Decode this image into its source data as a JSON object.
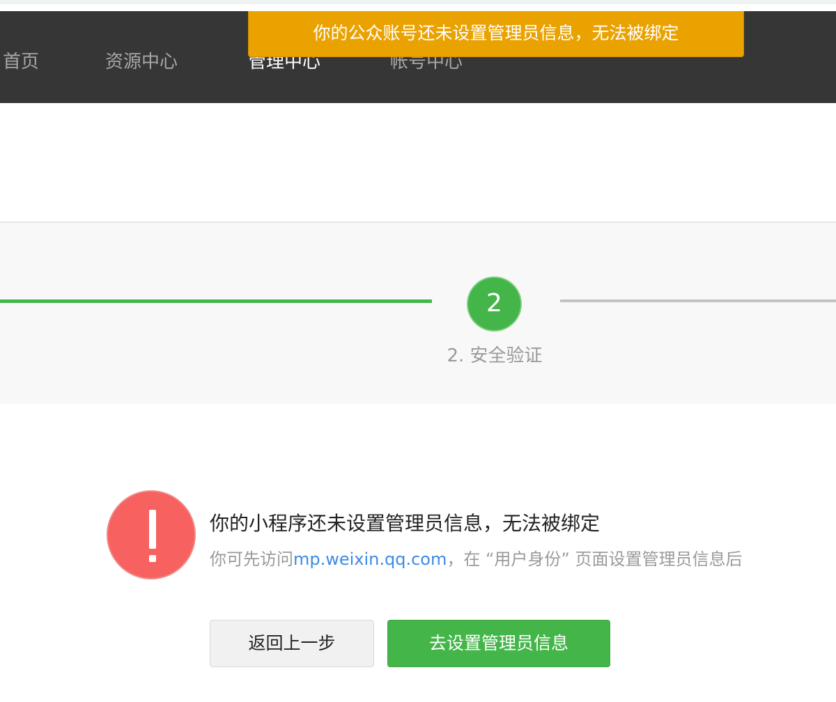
{
  "nav": {
    "items": [
      {
        "label": "首页"
      },
      {
        "label": "资源中心"
      },
      {
        "label": "管理中心"
      },
      {
        "label": "帐号中心"
      }
    ]
  },
  "toast": {
    "text": "你的公众账号还未设置管理员信息，无法被绑定"
  },
  "steps": {
    "current_number": "2",
    "current_label": "2. 安全验证"
  },
  "message": {
    "title": "你的小程序还未设置管理员信息，无法被绑定",
    "desc_prefix": "你可先访问",
    "desc_link": "mp.weixin.qq.com",
    "desc_suffix": "，在 “用户身份” 页面设置管理员信息后"
  },
  "buttons": {
    "back_label": "返回上一步",
    "go_label": "去设置管理员信息"
  },
  "colors": {
    "navbar": "#363636",
    "toast": "#eaa200",
    "accent_green": "#44b549",
    "warn_red": "#f76260",
    "link_blue": "#3d8ae5"
  }
}
